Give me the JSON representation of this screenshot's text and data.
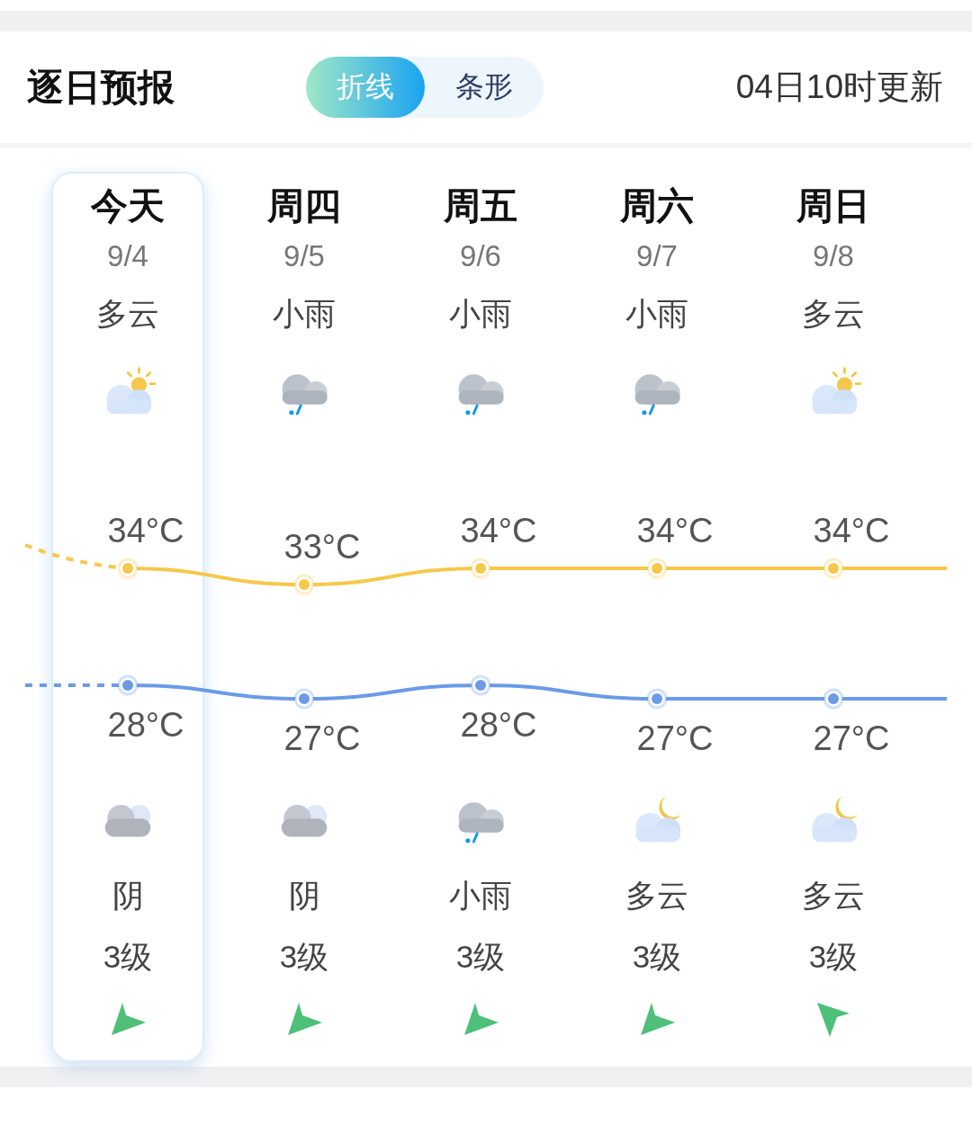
{
  "header": {
    "title": "逐日预报",
    "toggle": [
      {
        "label": "折线",
        "selected": true
      },
      {
        "label": "条形",
        "selected": false
      }
    ],
    "updated": "04日10时更新"
  },
  "days": [
    {
      "name": "今天",
      "date": "9/4",
      "day_weather": "多云",
      "day_icon": {
        "kind": "partly_cloudy"
      },
      "high": "34°C",
      "low": "28°C",
      "night_icon": {
        "kind": "overcast"
      },
      "night_weather": "阴",
      "wind": "3级",
      "wind_arrow": {
        "kind": "southwest"
      },
      "selected": true
    },
    {
      "name": "周四",
      "date": "9/5",
      "day_weather": "小雨",
      "day_icon": {
        "kind": "light_rain"
      },
      "high": "33°C",
      "low": "27°C",
      "night_icon": {
        "kind": "overcast"
      },
      "night_weather": "阴",
      "wind": "3级",
      "wind_arrow": {
        "kind": "southwest"
      },
      "selected": false
    },
    {
      "name": "周五",
      "date": "9/6",
      "day_weather": "小雨",
      "day_icon": {
        "kind": "light_rain"
      },
      "high": "34°C",
      "low": "28°C",
      "night_icon": {
        "kind": "light_rain"
      },
      "night_weather": "小雨",
      "wind": "3级",
      "wind_arrow": {
        "kind": "southwest"
      },
      "selected": false
    },
    {
      "name": "周六",
      "date": "9/7",
      "day_weather": "小雨",
      "day_icon": {
        "kind": "light_rain"
      },
      "high": "34°C",
      "low": "27°C",
      "night_icon": {
        "kind": "partly_cloudy_night"
      },
      "night_weather": "多云",
      "wind": "3级",
      "wind_arrow": {
        "kind": "southwest"
      },
      "selected": false
    },
    {
      "name": "周日",
      "date": "9/8",
      "day_weather": "多云",
      "day_icon": {
        "kind": "partly_cloudy"
      },
      "high": "34°C",
      "low": "27°C",
      "night_icon": {
        "kind": "partly_cloudy_night"
      },
      "night_weather": "多云",
      "wind": "3级",
      "wind_arrow": {
        "kind": "northwest"
      },
      "selected": false
    }
  ]
}
